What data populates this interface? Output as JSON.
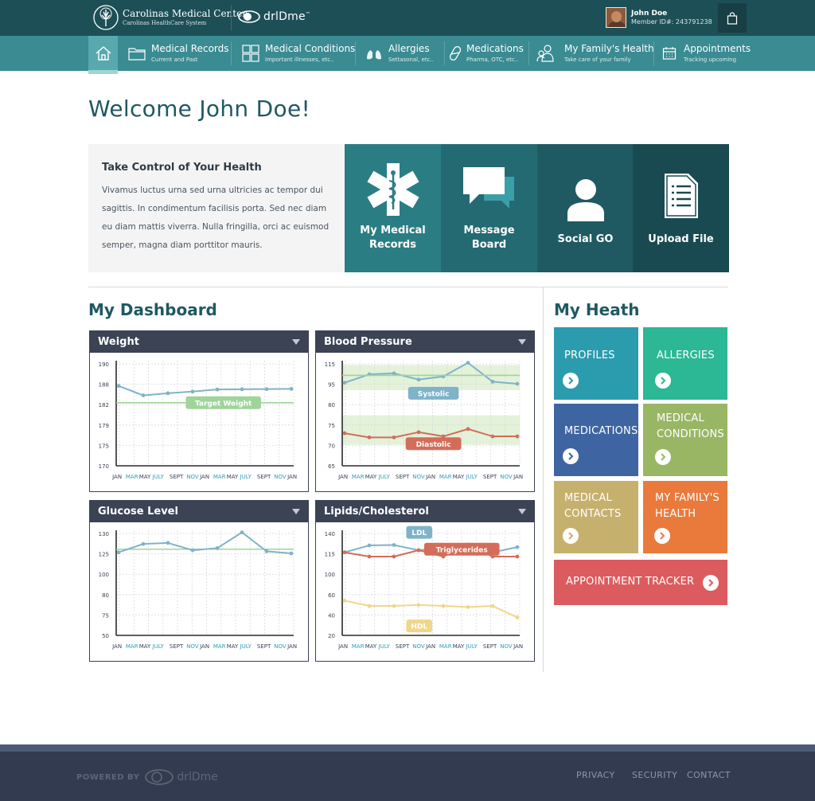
{
  "header": {
    "brand_name": "Carolinas Medical Center",
    "brand_sub": "Carolinas HealthCare System",
    "partner_logo": "drl",
    "partner_logo_suffix": "Dme",
    "partner_logo_tm": "™",
    "user_name": "John Doe",
    "member_id": "Member ID#: 243791238",
    "cart_icon": "shopping-bag-icon"
  },
  "nav": {
    "home_icon": "home-icon",
    "items": [
      {
        "title": "Medical Records",
        "sub": "Current and Past",
        "icon": "folder-icon"
      },
      {
        "title": "Medical Conditions",
        "sub": "Important illnesses, etc..",
        "icon": "grid-icon"
      },
      {
        "title": "Allergies",
        "sub": "Settasonal, etc..",
        "icon": "lungs-icon"
      },
      {
        "title": "Medications",
        "sub": "Pharma, OTC, etc..",
        "icon": "pill-icon"
      },
      {
        "title": "My Family's Health",
        "sub": "Take care of your family",
        "icon": "family-icon"
      },
      {
        "title": "Appointments",
        "sub": "Tracking upcoming",
        "icon": "calendar-icon"
      }
    ]
  },
  "welcome": "Welcome John Doe!",
  "info": {
    "title": "Take Control of Your Health",
    "body": "Vivamus luctus urna sed urna ultricies ac tempor dui sagittis. In condimentum facilisis porta. Sed nec diam eu diam mattis viverra. Nulla fringilla, orci ac euismod semper, magna diam porttitor mauris."
  },
  "quick_actions": [
    {
      "line1": "My Medical",
      "line2": "Records",
      "icon": "medical-star-icon",
      "color": "#2b7d84"
    },
    {
      "line1": "Message",
      "line2": "Board",
      "icon": "chat-bubbles-icon",
      "color": "#246a72"
    },
    {
      "line1": "Social GO",
      "line2": "",
      "icon": "person-icon",
      "color": "#1f5a62"
    },
    {
      "line1": "Upload File",
      "line2": "",
      "icon": "document-icon",
      "color": "#1a4a51"
    }
  ],
  "dashboard_title": "My Dashboard",
  "health_title": "My Heath",
  "months": [
    "JAN",
    "MAR",
    "MAY",
    "JULY",
    "SEPT",
    "NOV",
    "JAN",
    "MAR",
    "MAY",
    "JULY",
    "SEPT",
    "NOV",
    "JAN"
  ],
  "chart_data": [
    {
      "type": "line",
      "title": "Weight",
      "yticks": [
        "190",
        "188",
        "182",
        "179",
        "175",
        "170"
      ],
      "ylim": [
        0,
        5
      ],
      "series": [
        {
          "name": "",
          "color": "#7fb3c8",
          "values": [
            1.2,
            1.65,
            1.55,
            1.47,
            1.37,
            1.36,
            1.35,
            1.34
          ]
        },
        {
          "name": "Target Weight",
          "color": "#9fd49a",
          "values": [
            2.0,
            2.0
          ]
        }
      ],
      "annotations": [
        {
          "text": "Target Weight",
          "color": "#9fd49a"
        }
      ]
    },
    {
      "type": "line",
      "title": "Blood Pressure",
      "yticks": [
        "115",
        "95",
        "80",
        "75",
        "70",
        "65"
      ],
      "ylim": [
        0,
        5
      ],
      "bands": [
        [
          0.2,
          1.4
        ],
        [
          2.6,
          4.0
        ]
      ],
      "series": [
        {
          "name": "Systolic",
          "color": "#7fb3c8",
          "values": [
            1.05,
            0.65,
            0.6,
            0.9,
            0.75,
            0.1,
            1.0,
            1.1
          ]
        },
        {
          "name": "",
          "color": "#9fd49a",
          "values": [
            0.7,
            0.7
          ]
        },
        {
          "name": "Diastolic",
          "color": "#d36d5a",
          "values": [
            3.45,
            3.65,
            3.65,
            3.4,
            3.6,
            3.25,
            3.6,
            3.6
          ]
        }
      ],
      "annotations": [
        {
          "text": "Systolic",
          "color": "#7fb3c8"
        },
        {
          "text": "Diastolic",
          "color": "#d36d5a"
        }
      ]
    },
    {
      "type": "line",
      "title": "Glucose Level",
      "yticks": [
        "130",
        "125",
        "100",
        "80",
        "75",
        "50"
      ],
      "ylim": [
        0,
        5
      ],
      "series": [
        {
          "name": "",
          "color": "#9fd49a",
          "values": [
            0.9,
            0.9
          ]
        },
        {
          "name": "",
          "color": "#7fb3c8",
          "values": [
            1.05,
            0.65,
            0.6,
            0.95,
            0.85,
            0.1,
            1.0,
            1.1
          ]
        }
      ]
    },
    {
      "type": "line",
      "title": "Lipids/Cholesterol",
      "yticks": [
        "140",
        "115",
        "100",
        "60",
        "40",
        "20"
      ],
      "ylim": [
        0,
        5
      ],
      "series": [
        {
          "name": "LDL",
          "color": "#7fb3c8",
          "values": [
            1.05,
            0.72,
            0.7,
            0.95,
            0.8,
            0.68,
            1.05,
            0.8
          ]
        },
        {
          "name": "Triglycerides",
          "color": "#d36d5a",
          "values": [
            1.05,
            1.25,
            1.25,
            0.95,
            1.25,
            0.7,
            1.25,
            1.25
          ]
        },
        {
          "name": "HDL",
          "color": "#f1d68a",
          "values": [
            3.35,
            3.6,
            3.6,
            3.55,
            3.6,
            3.65,
            3.6,
            4.15
          ]
        }
      ],
      "annotations": [
        {
          "text": "LDL",
          "color": "#7fb3c8"
        },
        {
          "text": "Triglycerides",
          "color": "#d36d5a"
        },
        {
          "text": "HDL",
          "color": "#f1d68a"
        }
      ]
    }
  ],
  "health_tiles": [
    {
      "line1": "PROFILES",
      "line2": "",
      "color": "#2b9cae"
    },
    {
      "line1": "ALLERGIES",
      "line2": "",
      "color": "#2cb795"
    },
    {
      "line1": "MEDICATIONS",
      "line2": "",
      "color": "#3e65a2"
    },
    {
      "line1": "MEDICAL",
      "line2": "CONDITIONS",
      "color": "#99b665"
    },
    {
      "line1": "MEDICAL",
      "line2": "CONTACTS",
      "color": "#c6b06d"
    },
    {
      "line1": "MY FAMILY'S",
      "line2": "HEALTH",
      "color": "#e97a3c"
    },
    {
      "line1": "APPOINTMENT TRACKER",
      "line2": "",
      "color": "#dc5b5e"
    }
  ],
  "footer": {
    "powered_by": "POWERED BY",
    "logo": "drl",
    "logo_suffix": "Dme",
    "links": [
      "PRIVACY",
      "SECURITY",
      "CONTACT"
    ]
  }
}
